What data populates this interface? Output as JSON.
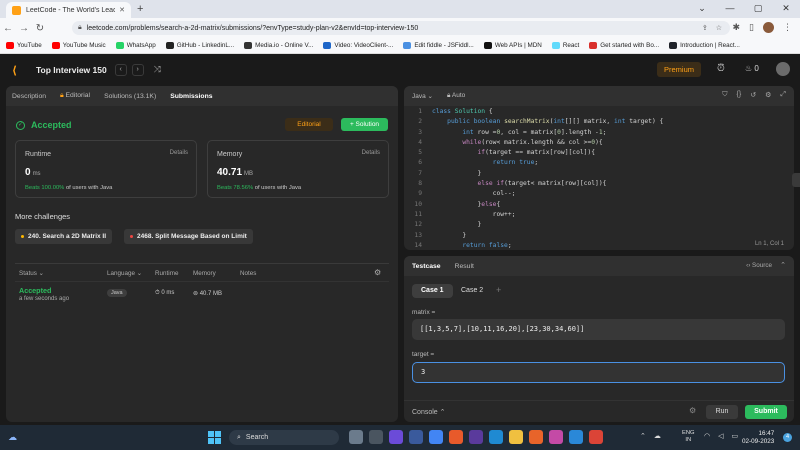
{
  "browser": {
    "tab_title": "LeetCode - The World's Leading",
    "url": "leetcode.com/problems/search-a-2d-matrix/submissions/?envType=study-plan-v2&envId=top-interview-150",
    "bookmarks": [
      {
        "label": "YouTube",
        "color": "#ff0000"
      },
      {
        "label": "YouTube Music",
        "color": "#ff0000"
      },
      {
        "label": "WhatsApp",
        "color": "#25d366"
      },
      {
        "label": "GitHub - LinkedinL...",
        "color": "#222222"
      },
      {
        "label": "Media.io - Online V...",
        "color": "#333333"
      },
      {
        "label": "Video: VideoClient-...",
        "color": "#1e66c8"
      },
      {
        "label": "Edit fiddle - JSFiddl...",
        "color": "#4a90e2"
      },
      {
        "label": "Web APIs | MDN",
        "color": "#111111"
      },
      {
        "label": "React",
        "color": "#61dafb"
      },
      {
        "label": "Get started with Bo...",
        "color": "#d9302c"
      },
      {
        "label": "Introduction | React...",
        "color": "#20232a"
      }
    ]
  },
  "header": {
    "study_title": "Top Interview 150",
    "premium_label": "Premium",
    "coins": "0"
  },
  "left_tabs": [
    "Description",
    "Editorial",
    "Solutions (13.1K)",
    "Submissions"
  ],
  "result": {
    "status": "Accepted",
    "editorial_btn": "Editorial",
    "solution_btn": "+ Solution",
    "runtime": {
      "label": "Runtime",
      "details": "Details",
      "value": "0",
      "unit": "ms",
      "beats": "Beats 100.00%",
      "suffix": "of users with Java"
    },
    "memory": {
      "label": "Memory",
      "details": "Details",
      "value": "40.71",
      "unit": "MB",
      "beats": "Beats 78.56%",
      "suffix": "of users with Java"
    }
  },
  "more_challenges": {
    "heading": "More challenges",
    "items": [
      {
        "label": "240. Search a 2D Matrix II",
        "color": "#ffb800"
      },
      {
        "label": "2468. Split Message Based on Limit",
        "color": "#ef4743"
      }
    ]
  },
  "submissions_table": {
    "headers": [
      "Status",
      "Language",
      "Runtime",
      "Memory",
      "Notes"
    ],
    "rows": [
      {
        "status": "Accepted",
        "time": "a few seconds ago",
        "language": "Java",
        "runtime": "0 ms",
        "memory": "40.7 MB"
      }
    ]
  },
  "editor": {
    "language": "Java",
    "mode": "Auto",
    "cursor": "Ln 1, Col 1",
    "lines": [
      "class Solution {",
      "    public boolean searchMatrix(int[][] matrix, int target) {",
      "        int row =0, col = matrix[0].length -1;",
      "        while(row< matrix.length && col >=0){",
      "            if(target == matrix[row][col]){",
      "                return true;",
      "            }",
      "            else if(target< matrix[row][col]){",
      "                col--;",
      "            }else{",
      "                row++;",
      "            }",
      "        }",
      "        return false;",
      "    }"
    ]
  },
  "testpanel": {
    "tabs": [
      "Testcase",
      "Result"
    ],
    "source_label": "Source",
    "cases": [
      "Case 1",
      "Case 2"
    ],
    "matrix_label": "matrix =",
    "matrix_value": "[[1,3,5,7],[10,11,16,20],[23,30,34,60]]",
    "target_label": "target =",
    "target_value": "3",
    "console_label": "Console",
    "run_label": "Run",
    "submit_label": "Submit"
  },
  "taskbar": {
    "search_label": "Search",
    "lang_top": "ENG",
    "lang_bottom": "IN",
    "time": "16:47",
    "date": "02-09-2023",
    "notifications": "4"
  },
  "colors": {
    "accent_green": "#2cbb5d",
    "accent_orange": "#ffa116",
    "editor_bg": "#282828"
  }
}
